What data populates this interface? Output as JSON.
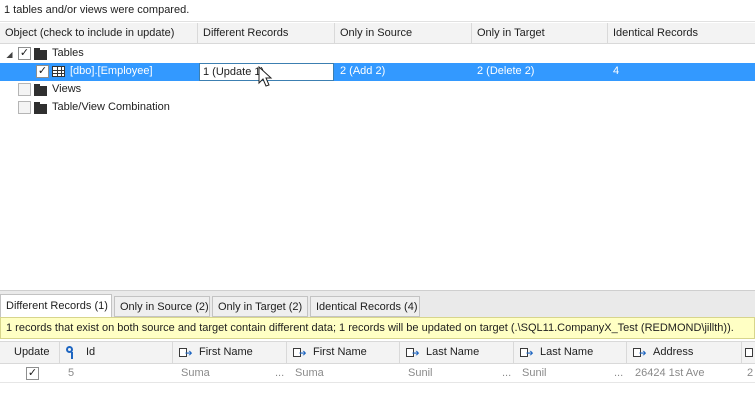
{
  "status": {
    "text": "1 tables and/or views were compared."
  },
  "grid": {
    "columns": [
      "Object (check to include in update)",
      "Different Records",
      "Only in Source",
      "Only in Target",
      "Identical Records"
    ],
    "tree": {
      "tables": {
        "label": "Tables",
        "checked": true
      },
      "employee": {
        "label": "[dbo].[Employee]",
        "different": "1 (Update 1)",
        "only_source": "2 (Add 2)",
        "only_target": "2 (Delete 2)",
        "identical": "4",
        "checked": true
      },
      "views": {
        "label": "Views",
        "checked": false
      },
      "combination": {
        "label": "Table/View Combination",
        "checked": false
      }
    }
  },
  "tabs": [
    "Different Records (1)",
    "Only in Source (2)",
    "Only in Target (2)",
    "Identical Records (4)"
  ],
  "info_bar": {
    "text": "1 records that exist on both source and target contain different data; 1 records will be updated on target (.\\SQL11.CompanyX_Test (REDMOND\\jillth))."
  },
  "detail": {
    "columns": {
      "update": "Update",
      "id": "Id",
      "first_name_source": "First Name",
      "first_name_target": "First Name",
      "last_name_source": "Last Name",
      "last_name_target": "Last Name",
      "address": "Address"
    },
    "row": {
      "id": "5",
      "first_name_source": "Suma",
      "first_name_target": "Suma",
      "last_name_source": "Sunil",
      "last_name_target": "Sunil",
      "address": "26424 1st Ave",
      "overflow": "2",
      "ellipsis": "...",
      "update_checked": true
    }
  },
  "colors": {
    "selection": "#3399ff",
    "info_bar": "#ffffc4",
    "key_icon": "#1d65c1"
  }
}
